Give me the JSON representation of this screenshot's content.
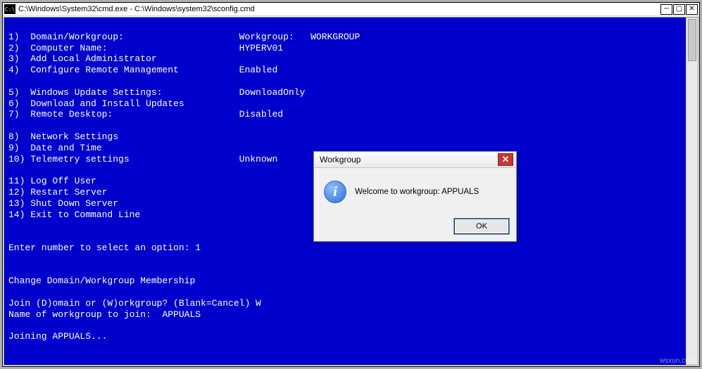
{
  "window": {
    "title": "C:\\Windows\\System32\\cmd.exe - C:\\Windows\\system32\\sconfig.cmd",
    "icon_glyph": "C:\\"
  },
  "console": {
    "menu": [
      {
        "n": "1",
        "label": "Domain/Workgroup:",
        "val_label": "Workgroup:",
        "val": "WORKGROUP"
      },
      {
        "n": "2",
        "label": "Computer Name:",
        "val_label": "",
        "val": "HYPERV01"
      },
      {
        "n": "3",
        "label": "Add Local Administrator",
        "val_label": "",
        "val": ""
      },
      {
        "n": "4",
        "label": "Configure Remote Management",
        "val_label": "",
        "val": "Enabled"
      },
      {
        "n": "",
        "label": "",
        "val_label": "",
        "val": ""
      },
      {
        "n": "5",
        "label": "Windows Update Settings:",
        "val_label": "",
        "val": "DownloadOnly"
      },
      {
        "n": "6",
        "label": "Download and Install Updates",
        "val_label": "",
        "val": ""
      },
      {
        "n": "7",
        "label": "Remote Desktop:",
        "val_label": "",
        "val": "Disabled"
      },
      {
        "n": "",
        "label": "",
        "val_label": "",
        "val": ""
      },
      {
        "n": "8",
        "label": "Network Settings",
        "val_label": "",
        "val": ""
      },
      {
        "n": "9",
        "label": "Date and Time",
        "val_label": "",
        "val": ""
      },
      {
        "n": "10",
        "label": "Telemetry settings",
        "val_label": "",
        "val": "Unknown"
      },
      {
        "n": "",
        "label": "",
        "val_label": "",
        "val": ""
      },
      {
        "n": "11",
        "label": "Log Off User",
        "val_label": "",
        "val": ""
      },
      {
        "n": "12",
        "label": "Restart Server",
        "val_label": "",
        "val": ""
      },
      {
        "n": "13",
        "label": "Shut Down Server",
        "val_label": "",
        "val": ""
      },
      {
        "n": "14",
        "label": "Exit to Command Line",
        "val_label": "",
        "val": ""
      }
    ],
    "prompt": "Enter number to select an option: 1",
    "section_header": "Change Domain/Workgroup Membership",
    "q1": "Join (D)omain or (W)orkgroup? (Blank=Cancel) W",
    "q2": "Name of workgroup to join:  APPUALS",
    "status": "Joining APPUALS..."
  },
  "dialog": {
    "title": "Workgroup",
    "message": "Welcome to workgroup: APPUALS",
    "ok_label": "OK",
    "close_label": "✕"
  },
  "watermark": "wsxun.com"
}
